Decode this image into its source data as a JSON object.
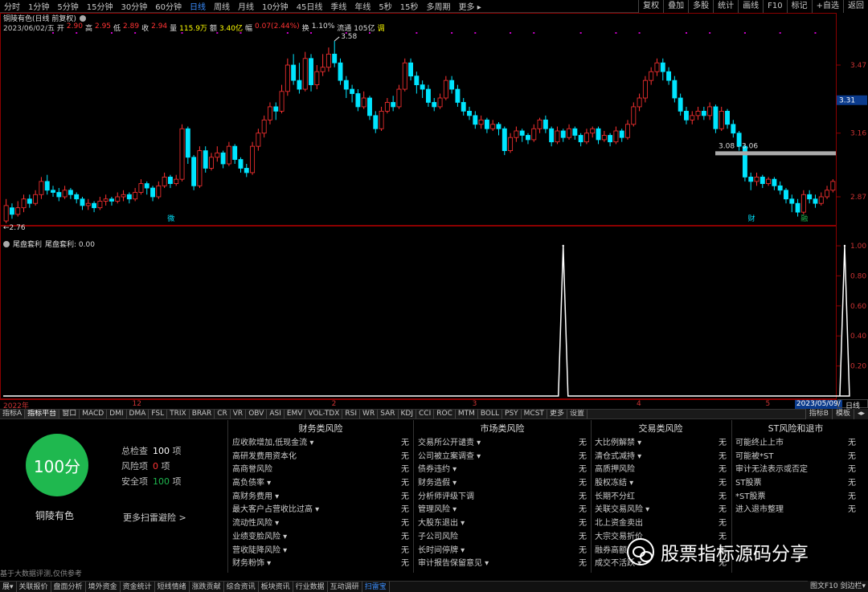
{
  "toolbar": {
    "periods": [
      "分时",
      "1分钟",
      "5分钟",
      "15分钟",
      "30分钟",
      "60分钟",
      "日线",
      "周线",
      "月线",
      "10分钟",
      "45日线",
      "季线",
      "年线",
      "5秒",
      "15秒",
      "多周期",
      "更多 ▸"
    ],
    "active_period": "日线",
    "right_tools": [
      "复权",
      "叠加",
      "多股",
      "统计",
      "画线",
      "F10",
      "标记",
      "+自选",
      "返回"
    ]
  },
  "header": {
    "title": "铜陵有色(日线 前复权)",
    "date": "2023/06/02/五",
    "open_label": "开",
    "open": "2.90",
    "high_label": "高",
    "high": "2.95",
    "low_label": "低",
    "low": "2.89",
    "close_label": "收",
    "close": "2.94",
    "vol_label": "量",
    "vol": "115.9万",
    "amt_label": "额",
    "amt": "3.40亿",
    "chg_label": "幅",
    "chg": "0.07(2.44%)",
    "turn_label": "换",
    "turn": "1.10%",
    "float_label": "流通",
    "float": "105亿",
    "tag": "调"
  },
  "chart": {
    "price_ticks": [
      "3.47",
      "3.16",
      "2.87"
    ],
    "current_price": "3.31",
    "band_label": "3.08 - 3.06",
    "max_label": "3.58",
    "min_label": "2.76",
    "event_markers": [
      "微",
      "财",
      "融",
      "$"
    ],
    "candles": [
      [
        2.76,
        2.83,
        2.75,
        2.86
      ],
      [
        2.82,
        2.79,
        2.77,
        2.84
      ],
      [
        2.79,
        2.82,
        2.78,
        2.85
      ],
      [
        2.82,
        2.86,
        2.8,
        2.88
      ],
      [
        2.86,
        2.84,
        2.82,
        2.88
      ],
      [
        2.84,
        2.88,
        2.83,
        2.9
      ],
      [
        2.88,
        2.94,
        2.86,
        2.96
      ],
      [
        2.94,
        2.9,
        2.88,
        2.97
      ],
      [
        2.9,
        2.89,
        2.87,
        2.92
      ],
      [
        2.89,
        2.87,
        2.85,
        2.91
      ],
      [
        2.87,
        2.9,
        2.86,
        2.92
      ],
      [
        2.9,
        2.88,
        2.86,
        2.91
      ],
      [
        2.88,
        2.86,
        2.84,
        2.89
      ],
      [
        2.86,
        2.83,
        2.81,
        2.87
      ],
      [
        2.83,
        2.84,
        2.81,
        2.86
      ],
      [
        2.84,
        2.82,
        2.8,
        2.85
      ],
      [
        2.82,
        2.85,
        2.81,
        2.87
      ],
      [
        2.85,
        2.86,
        2.83,
        2.88
      ],
      [
        2.86,
        2.85,
        2.83,
        2.87
      ],
      [
        2.85,
        2.87,
        2.84,
        2.89
      ],
      [
        2.87,
        2.88,
        2.85,
        2.9
      ],
      [
        2.88,
        2.86,
        2.84,
        2.89
      ],
      [
        2.86,
        2.89,
        2.85,
        2.91
      ],
      [
        2.89,
        2.93,
        2.88,
        2.95
      ],
      [
        2.93,
        2.91,
        2.88,
        2.94
      ],
      [
        2.91,
        2.87,
        2.85,
        2.92
      ],
      [
        2.87,
        2.92,
        2.86,
        2.94
      ],
      [
        2.92,
        2.96,
        2.91,
        2.98
      ],
      [
        2.96,
        2.93,
        2.91,
        2.97
      ],
      [
        2.93,
        2.95,
        2.92,
        2.97
      ],
      [
        2.95,
        3.18,
        2.94,
        3.2
      ],
      [
        3.18,
        3.05,
        3.02,
        3.19
      ],
      [
        3.05,
        2.92,
        2.9,
        3.06
      ],
      [
        2.92,
        3.08,
        2.91,
        3.1
      ],
      [
        3.08,
        3.0,
        2.98,
        3.1
      ],
      [
        3.0,
        3.05,
        2.99,
        3.07
      ],
      [
        3.05,
        3.07,
        3.03,
        3.1
      ],
      [
        3.07,
        3.02,
        3.0,
        3.08
      ],
      [
        3.02,
        3.1,
        3.01,
        3.12
      ],
      [
        3.1,
        3.04,
        3.02,
        3.11
      ],
      [
        3.04,
        3.0,
        2.98,
        3.05
      ],
      [
        3.0,
        2.98,
        2.96,
        3.02
      ],
      [
        2.98,
        3.1,
        2.97,
        3.12
      ],
      [
        3.1,
        3.16,
        3.08,
        3.18
      ],
      [
        3.16,
        3.22,
        3.14,
        3.24
      ],
      [
        3.22,
        3.28,
        3.2,
        3.3
      ],
      [
        3.28,
        3.26,
        3.22,
        3.3
      ],
      [
        3.26,
        3.35,
        3.25,
        3.38
      ],
      [
        3.35,
        3.47,
        3.33,
        3.5
      ],
      [
        3.47,
        3.4,
        3.38,
        3.52
      ],
      [
        3.4,
        3.36,
        3.34,
        3.48
      ],
      [
        3.36,
        3.5,
        3.35,
        3.53
      ],
      [
        3.5,
        3.38,
        3.35,
        3.52
      ],
      [
        3.38,
        3.44,
        3.36,
        3.47
      ],
      [
        3.44,
        3.46,
        3.42,
        3.52
      ],
      [
        3.46,
        3.52,
        3.44,
        3.55
      ],
      [
        3.52,
        3.48,
        3.46,
        3.58
      ],
      [
        3.48,
        3.4,
        3.38,
        3.5
      ],
      [
        3.4,
        3.36,
        3.32,
        3.42
      ],
      [
        3.36,
        3.34,
        3.3,
        3.38
      ],
      [
        3.34,
        3.28,
        3.26,
        3.36
      ],
      [
        3.28,
        3.32,
        3.27,
        3.35
      ],
      [
        3.32,
        3.24,
        3.22,
        3.33
      ],
      [
        3.24,
        3.18,
        3.16,
        3.26
      ],
      [
        3.18,
        3.26,
        3.17,
        3.28
      ],
      [
        3.26,
        3.3,
        3.25,
        3.32
      ],
      [
        3.3,
        3.28,
        3.26,
        3.33
      ],
      [
        3.28,
        3.36,
        3.27,
        3.38
      ],
      [
        3.36,
        3.48,
        3.35,
        3.5
      ],
      [
        3.48,
        3.42,
        3.4,
        3.5
      ],
      [
        3.42,
        3.38,
        3.34,
        3.44
      ],
      [
        3.38,
        3.36,
        3.32,
        3.4
      ],
      [
        3.36,
        3.3,
        3.28,
        3.38
      ],
      [
        3.3,
        3.28,
        3.26,
        3.32
      ],
      [
        3.28,
        3.32,
        3.27,
        3.34
      ],
      [
        3.32,
        3.4,
        3.31,
        3.42
      ],
      [
        3.4,
        3.36,
        3.34,
        3.42
      ],
      [
        3.36,
        3.3,
        3.28,
        3.38
      ],
      [
        3.3,
        3.26,
        3.24,
        3.32
      ],
      [
        3.26,
        3.24,
        3.22,
        3.28
      ],
      [
        3.24,
        3.2,
        3.18,
        3.26
      ],
      [
        3.2,
        3.22,
        3.18,
        3.24
      ],
      [
        3.22,
        3.18,
        3.16,
        3.23
      ],
      [
        3.18,
        3.2,
        3.17,
        3.22
      ],
      [
        3.2,
        3.18,
        3.15,
        3.21
      ],
      [
        3.18,
        3.08,
        3.06,
        3.19
      ],
      [
        3.08,
        3.14,
        3.07,
        3.16
      ],
      [
        3.14,
        3.17,
        3.12,
        3.19
      ],
      [
        3.17,
        3.15,
        3.12,
        3.18
      ],
      [
        3.15,
        3.13,
        3.11,
        3.16
      ],
      [
        3.13,
        3.18,
        3.12,
        3.2
      ],
      [
        3.18,
        3.22,
        3.16,
        3.23
      ],
      [
        3.22,
        3.18,
        3.16,
        3.24
      ],
      [
        3.18,
        3.12,
        3.1,
        3.19
      ],
      [
        3.12,
        3.17,
        3.11,
        3.19
      ],
      [
        3.17,
        3.14,
        3.12,
        3.18
      ],
      [
        3.14,
        3.18,
        3.13,
        3.2
      ],
      [
        3.18,
        3.15,
        3.13,
        3.19
      ],
      [
        3.15,
        3.12,
        3.1,
        3.16
      ],
      [
        3.12,
        3.16,
        3.11,
        3.18
      ],
      [
        3.16,
        3.18,
        3.14,
        3.19
      ],
      [
        3.18,
        3.13,
        3.11,
        3.19
      ],
      [
        3.13,
        3.15,
        3.12,
        3.17
      ],
      [
        3.15,
        3.12,
        3.1,
        3.16
      ],
      [
        3.12,
        3.17,
        3.11,
        3.19
      ],
      [
        3.17,
        3.14,
        3.12,
        3.18
      ],
      [
        3.14,
        3.2,
        3.13,
        3.22
      ],
      [
        3.2,
        3.28,
        3.19,
        3.3
      ],
      [
        3.28,
        3.32,
        3.26,
        3.34
      ],
      [
        3.32,
        3.4,
        3.3,
        3.42
      ],
      [
        3.4,
        3.44,
        3.38,
        3.46
      ],
      [
        3.44,
        3.48,
        3.42,
        3.5
      ],
      [
        3.48,
        3.44,
        3.4,
        3.5
      ],
      [
        3.44,
        3.4,
        3.38,
        3.46
      ],
      [
        3.4,
        3.32,
        3.3,
        3.42
      ],
      [
        3.32,
        3.26,
        3.24,
        3.34
      ],
      [
        3.26,
        3.22,
        3.2,
        3.28
      ],
      [
        3.22,
        3.24,
        3.2,
        3.26
      ],
      [
        3.24,
        3.26,
        3.22,
        3.28
      ],
      [
        3.26,
        3.24,
        3.22,
        3.28
      ],
      [
        3.24,
        3.28,
        3.22,
        3.3
      ],
      [
        3.28,
        3.18,
        3.16,
        3.29
      ],
      [
        3.18,
        3.26,
        3.17,
        3.28
      ],
      [
        3.26,
        3.2,
        3.18,
        3.27
      ],
      [
        3.2,
        3.16,
        3.14,
        3.22
      ],
      [
        3.16,
        3.1,
        3.08,
        3.17
      ],
      [
        3.1,
        2.96,
        2.94,
        3.11
      ],
      [
        2.96,
        2.94,
        2.9,
        2.98
      ],
      [
        2.94,
        2.96,
        2.92,
        2.98
      ],
      [
        2.96,
        2.93,
        2.91,
        2.97
      ],
      [
        2.93,
        2.95,
        2.92,
        2.96
      ],
      [
        2.95,
        2.92,
        2.9,
        2.96
      ],
      [
        2.92,
        2.9,
        2.88,
        2.94
      ],
      [
        2.9,
        2.86,
        2.84,
        2.91
      ],
      [
        2.86,
        2.84,
        2.8,
        2.88
      ],
      [
        2.84,
        2.8,
        2.78,
        2.86
      ],
      [
        2.8,
        2.88,
        2.79,
        2.9
      ],
      [
        2.88,
        2.86,
        2.84,
        2.9
      ],
      [
        2.86,
        2.84,
        2.82,
        2.88
      ],
      [
        2.84,
        2.87,
        2.83,
        2.89
      ],
      [
        2.87,
        2.9,
        2.86,
        2.92
      ],
      [
        2.9,
        2.94,
        2.89,
        2.95
      ]
    ],
    "markers_purple_idx": [
      8,
      12,
      18,
      22,
      30,
      36,
      40,
      48,
      52,
      58,
      62,
      70,
      76,
      80,
      86,
      90,
      98,
      104,
      108,
      116,
      120,
      126,
      132,
      138
    ]
  },
  "indicator": {
    "title": "尾盘套利",
    "readout": "尾盘套利: 0.00",
    "ticks": [
      "1.00",
      "0.80",
      "0.60",
      "0.40",
      "0.20"
    ],
    "spikes": [
      {
        "index": 95,
        "value": 1.0
      },
      {
        "index": 143,
        "value": 1.0
      }
    ]
  },
  "time_axis": {
    "labels": [
      {
        "index": 0,
        "text": "2022年"
      },
      {
        "index": 22,
        "text": "12"
      },
      {
        "index": 56,
        "text": "2"
      },
      {
        "index": 80,
        "text": "3"
      },
      {
        "index": 108,
        "text": "4"
      },
      {
        "index": 130,
        "text": "5"
      },
      {
        "index": 155,
        "text": "6"
      }
    ],
    "highlight": "2023/05/09/二",
    "period": "日线"
  },
  "indicator_tabs": [
    "指标A",
    "指标平台",
    "窗口",
    "MACD",
    "DMI",
    "DMA",
    "FSL",
    "TRIX",
    "BRAR",
    "CR",
    "VR",
    "OBV",
    "ASI",
    "EMV",
    "VOL-TDX",
    "RSI",
    "WR",
    "SAR",
    "KDJ",
    "CCI",
    "ROC",
    "MTM",
    "BOLL",
    "PSY",
    "MCST",
    "更多",
    "设置"
  ],
  "active_indicator_tab": "指标平台",
  "indicator_tabs_right": [
    "指标B",
    "模板",
    "◂▸"
  ],
  "risk": {
    "score": "100分",
    "stock_name": "铜陵有色",
    "total_label": "总检查",
    "total_value": "100",
    "risk_label": "风险项",
    "risk_value": "0",
    "safe_label": "安全项",
    "safe_value": "100",
    "unit": "项",
    "more_link": "更多扫雷避险 >",
    "note": "基于大数据评测,仅供参考",
    "columns": [
      {
        "title": "财务类风险",
        "items": [
          {
            "label": "应收款增加,低现金流 ▾",
            "value": "无"
          },
          {
            "label": "高研发费用资本化",
            "value": "无"
          },
          {
            "label": "高商誉风险",
            "value": "无"
          },
          {
            "label": "高负债率 ▾",
            "value": "无"
          },
          {
            "label": "高财务费用 ▾",
            "value": "无"
          },
          {
            "label": "最大客户占营收比过高 ▾",
            "value": "无"
          },
          {
            "label": "流动性风险 ▾",
            "value": "无"
          },
          {
            "label": "业绩变脸风险 ▾",
            "value": "无"
          },
          {
            "label": "营收陡降风险 ▾",
            "value": "无"
          },
          {
            "label": "财务粉饰 ▾",
            "value": "无"
          }
        ]
      },
      {
        "title": "市场类风险",
        "items": [
          {
            "label": "交易所公开谴责 ▾",
            "value": "无"
          },
          {
            "label": "公司被立案调查 ▾",
            "value": "无"
          },
          {
            "label": "债券违约 ▾",
            "value": "无"
          },
          {
            "label": "财务造假 ▾",
            "value": "无"
          },
          {
            "label": "分析师评级下调",
            "value": "无"
          },
          {
            "label": "管理风险 ▾",
            "value": "无"
          },
          {
            "label": "大股东退出 ▾",
            "value": "无"
          },
          {
            "label": "子公司风险",
            "value": "无"
          },
          {
            "label": "长时间停牌 ▾",
            "value": "无"
          },
          {
            "label": "审计报告保留意见 ▾",
            "value": "无"
          }
        ]
      },
      {
        "title": "交易类风险",
        "items": [
          {
            "label": "大比例解禁 ▾",
            "value": "无"
          },
          {
            "label": "清仓式减持 ▾",
            "value": "无"
          },
          {
            "label": "高质押风险",
            "value": "无"
          },
          {
            "label": "股权冻结 ▾",
            "value": "无"
          },
          {
            "label": "长期不分红",
            "value": "无"
          },
          {
            "label": "关联交易风险 ▾",
            "value": "无"
          },
          {
            "label": "北上资金卖出",
            "value": "无"
          },
          {
            "label": "大宗交易折价",
            "value": "无"
          },
          {
            "label": "融券高额",
            "value": "无"
          },
          {
            "label": "成交不活跃 ▾",
            "value": "无"
          }
        ]
      },
      {
        "title": "ST风险和退市",
        "items": [
          {
            "label": "可能终止上市",
            "value": "无"
          },
          {
            "label": "可能被*ST",
            "value": "无"
          },
          {
            "label": "审计无法表示或否定",
            "value": "无"
          },
          {
            "label": "ST股票",
            "value": "无"
          },
          {
            "label": "*ST股票",
            "value": "无"
          },
          {
            "label": "进入退市整理",
            "value": "无"
          }
        ]
      }
    ]
  },
  "watermark": {
    "text": "股票指标源码分享"
  },
  "bottom_bar": [
    "展▾",
    "关联报价",
    "盘面分析",
    "境外资金",
    "资金统计",
    "短线情绪",
    "涨跌贡献",
    "综合资讯",
    "板块资讯",
    "行业数据",
    "互动调研",
    "扫雷宝"
  ],
  "active_bottom": "扫雷宝",
  "bottom_right": "图文F10 剑边栏▾",
  "colors": {
    "up": "#ff3232",
    "down": "#00e5ff",
    "grid": "#8b0000",
    "marker": "#c800c8"
  }
}
